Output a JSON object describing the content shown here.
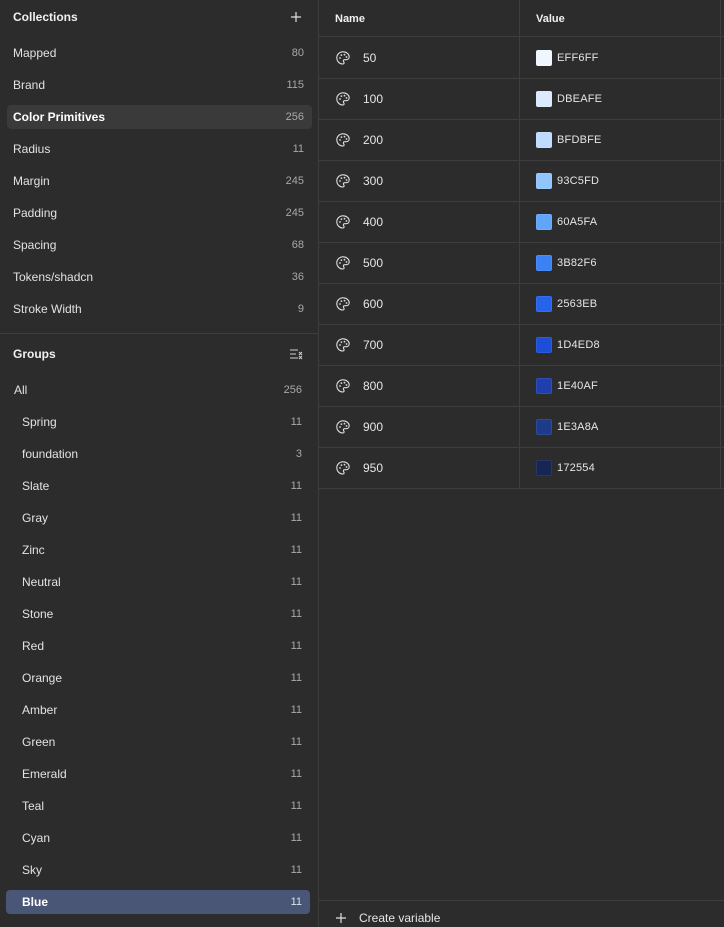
{
  "collections": {
    "title": "Collections",
    "items": [
      {
        "label": "Mapped",
        "count": "80"
      },
      {
        "label": "Brand",
        "count": "115"
      },
      {
        "label": "Color Primitives",
        "count": "256"
      },
      {
        "label": "Radius",
        "count": "11"
      },
      {
        "label": "Margin",
        "count": "245"
      },
      {
        "label": "Padding",
        "count": "245"
      },
      {
        "label": "Spacing",
        "count": "68"
      },
      {
        "label": "Tokens/shadcn",
        "count": "36"
      },
      {
        "label": "Stroke Width",
        "count": "9"
      }
    ],
    "selected": "Color Primitives"
  },
  "groups": {
    "title": "Groups",
    "items": [
      {
        "label": "All",
        "count": "256"
      },
      {
        "label": "Spring",
        "count": "11"
      },
      {
        "label": "foundation",
        "count": "3"
      },
      {
        "label": "Slate",
        "count": "11"
      },
      {
        "label": "Gray",
        "count": "11"
      },
      {
        "label": "Zinc",
        "count": "11"
      },
      {
        "label": "Neutral",
        "count": "11"
      },
      {
        "label": "Stone",
        "count": "11"
      },
      {
        "label": "Red",
        "count": "11"
      },
      {
        "label": "Orange",
        "count": "11"
      },
      {
        "label": "Amber",
        "count": "11"
      },
      {
        "label": "Green",
        "count": "11"
      },
      {
        "label": "Emerald",
        "count": "11"
      },
      {
        "label": "Teal",
        "count": "11"
      },
      {
        "label": "Cyan",
        "count": "11"
      },
      {
        "label": "Sky",
        "count": "11"
      },
      {
        "label": "Blue",
        "count": "11"
      }
    ],
    "selected": "Blue"
  },
  "table": {
    "columns": {
      "name": "Name",
      "value": "Value"
    },
    "rows": [
      {
        "name": "50",
        "value": "EFF6FF",
        "color": "#EFF6FF"
      },
      {
        "name": "100",
        "value": "DBEAFE",
        "color": "#DBEAFE"
      },
      {
        "name": "200",
        "value": "BFDBFE",
        "color": "#BFDBFE"
      },
      {
        "name": "300",
        "value": "93C5FD",
        "color": "#93C5FD"
      },
      {
        "name": "400",
        "value": "60A5FA",
        "color": "#60A5FA"
      },
      {
        "name": "500",
        "value": "3B82F6",
        "color": "#3B82F6"
      },
      {
        "name": "600",
        "value": "2563EB",
        "color": "#2563EB"
      },
      {
        "name": "700",
        "value": "1D4ED8",
        "color": "#1D4ED8"
      },
      {
        "name": "800",
        "value": "1E40AF",
        "color": "#1E40AF"
      },
      {
        "name": "900",
        "value": "1E3A8A",
        "color": "#1E3A8A"
      },
      {
        "name": "950",
        "value": "172554",
        "color": "#172554"
      }
    ],
    "row_icon": "palette-icon"
  },
  "footer": {
    "create_label": "Create variable",
    "icon": "plus-icon"
  },
  "icons": {
    "add_collection": "plus-icon",
    "groups_action": "collapse-list-icon"
  }
}
